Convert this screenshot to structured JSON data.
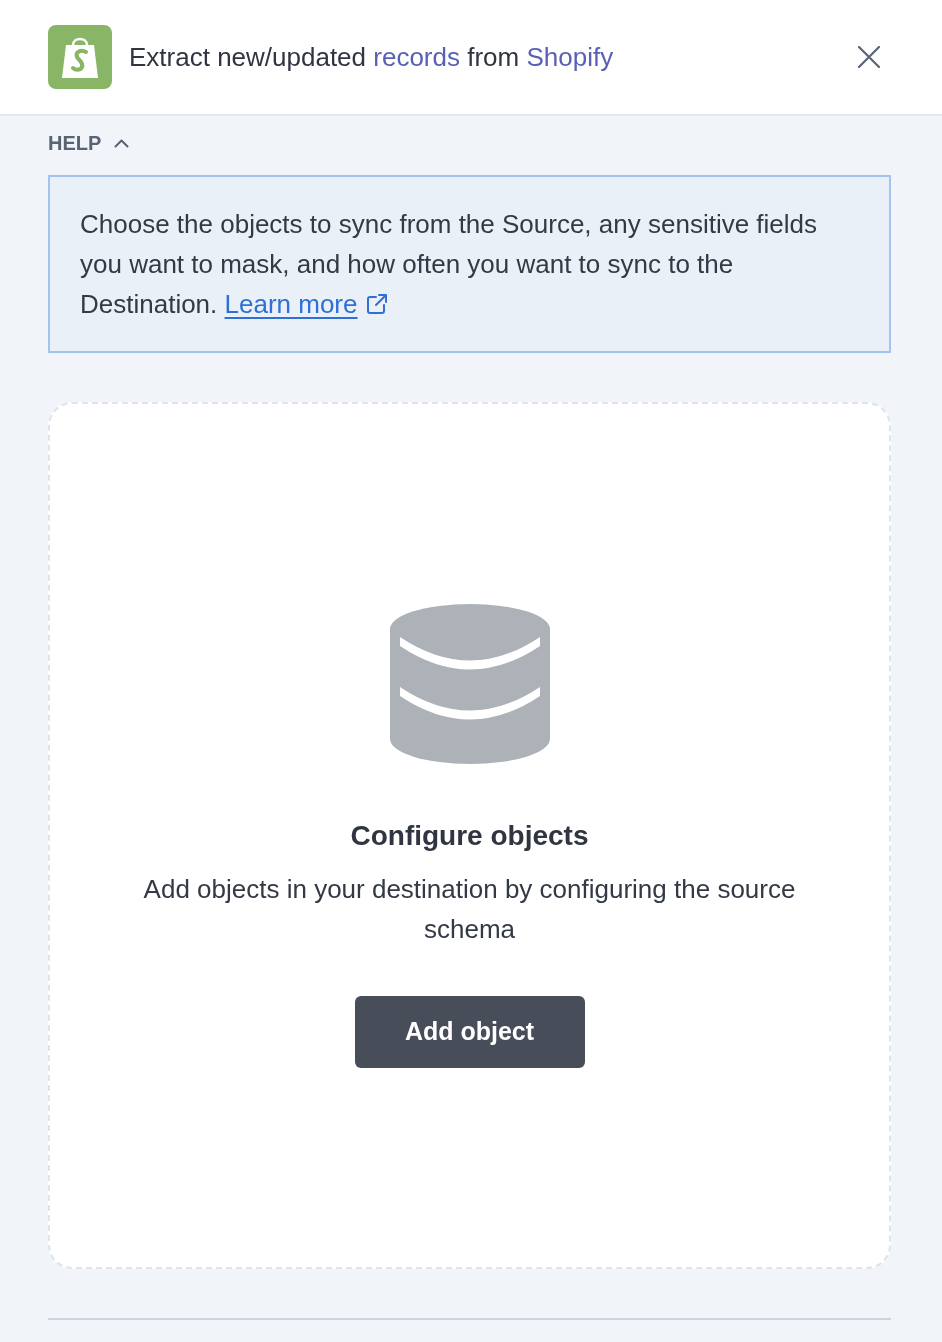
{
  "header": {
    "title_parts": [
      {
        "text": "Extract new/updated",
        "kind": "plain"
      },
      {
        "text": "records",
        "kind": "accent"
      },
      {
        "text": "from",
        "kind": "plain"
      },
      {
        "text": "Shopify",
        "kind": "accent"
      }
    ]
  },
  "help": {
    "label": "HELP",
    "expanded": true,
    "text": "Choose the objects to sync from the Source, any sensitive fields you want to mask, and how often you want to sync to the Destination.",
    "link": "Learn more"
  },
  "empty_state": {
    "title": "Configure objects",
    "description": "Add objects in your destination by configuring the source schema",
    "button": "Add object"
  }
}
